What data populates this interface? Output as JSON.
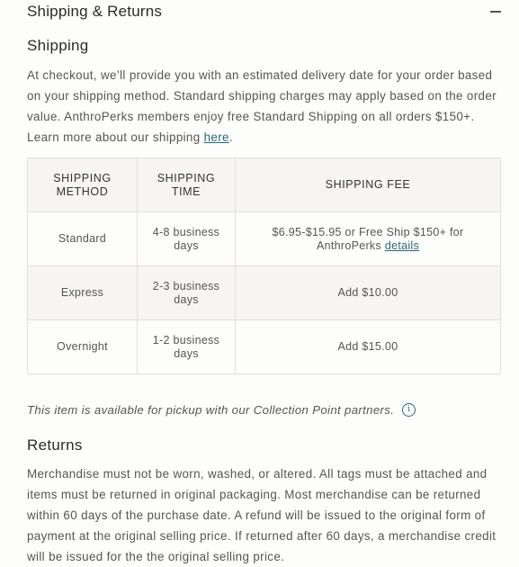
{
  "accordion": {
    "title": "Shipping & Returns",
    "toggle_icon": "minus-icon"
  },
  "shipping": {
    "heading": "Shipping",
    "body_text": "At checkout, we’ll provide you with an estimated delivery date for your order based on your shipping method. Standard shipping charges may apply based on the order value. AnthroPerks members enjoy free Standard Shipping on all orders $150+. Learn more about our shipping ",
    "link_label": "here",
    "link_suffix": "."
  },
  "table": {
    "headers": [
      "SHIPPING METHOD",
      "SHIPPING TIME",
      "SHIPPING FEE"
    ],
    "rows": [
      {
        "method": "Standard",
        "time": "4-8 business days",
        "fee": "$6.95-$15.95 or Free Ship $150+ for AnthroPerks ",
        "fee_link": "details"
      },
      {
        "method": "Express",
        "time": "2-3 business days",
        "fee": "Add $10.00"
      },
      {
        "method": "Overnight",
        "time": "1-2 business days",
        "fee": "Add $15.00"
      }
    ]
  },
  "pickup": {
    "text": "This item is available for pickup with our Collection Point partners.",
    "icon": "info-icon"
  },
  "returns": {
    "heading": "Returns",
    "body_text": "Merchandise must not be worn, washed, or altered. All tags must be attached and items must be returned in original packaging. Most merchandise can be returned within 60 days of the purchase date. A refund will be issued to the original form of payment at the original selling price. If returned after 60 days, a merchandise credit will be issued for the the original selling price."
  },
  "colors": {
    "background": "#fdfdfb",
    "link": "#2a6b78",
    "table_header_bg": "#f6f5f3",
    "border": "#e2e0dc"
  }
}
